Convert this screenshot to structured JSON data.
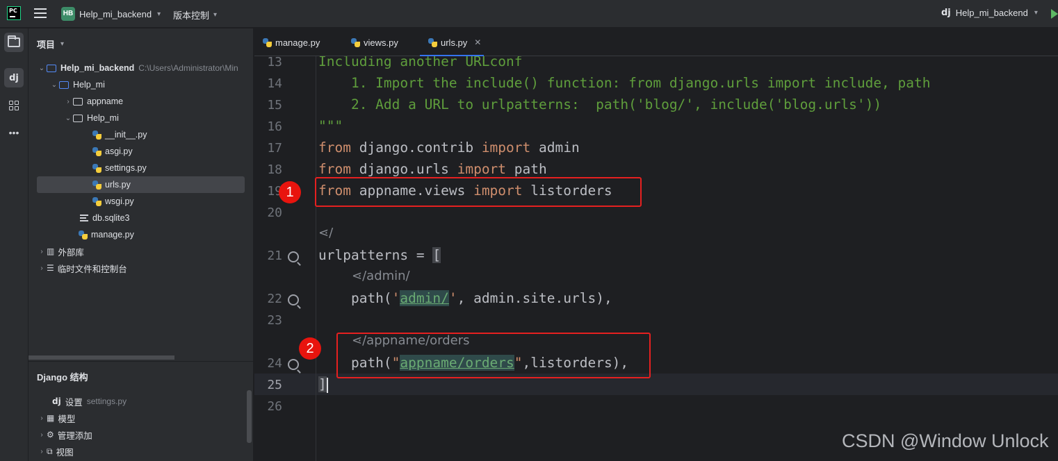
{
  "titlebar": {
    "project_badge": "HB",
    "project_name": "Help_mi_backend",
    "vcs_label": "版本控制",
    "run_config_icon": "dj",
    "run_config_name": "Help_mi_backend"
  },
  "sidebar_strip": {
    "icons": [
      "folder-icon",
      "django-icon",
      "structure-icon",
      "more-icon"
    ]
  },
  "project_panel": {
    "title": "项目",
    "tree": [
      {
        "label": "Help_mi_backend",
        "hint": "C:\\Users\\Administrator\\Min",
        "type": "root-folder",
        "expanded": true
      },
      {
        "label": "Help_mi",
        "type": "folder",
        "expanded": true
      },
      {
        "label": "appname",
        "type": "package",
        "expanded": false
      },
      {
        "label": "Help_mi",
        "type": "package",
        "expanded": true
      },
      {
        "label": "__init__.py",
        "type": "python-file"
      },
      {
        "label": "asgi.py",
        "type": "python-file"
      },
      {
        "label": "settings.py",
        "type": "python-file"
      },
      {
        "label": "urls.py",
        "type": "python-file",
        "selected": true
      },
      {
        "label": "wsgi.py",
        "type": "python-file"
      },
      {
        "label": "db.sqlite3",
        "type": "database-file"
      },
      {
        "label": "manage.py",
        "type": "python-file"
      },
      {
        "label": "外部库",
        "type": "library"
      },
      {
        "label": "临时文件和控制台",
        "type": "scratches"
      }
    ]
  },
  "django_structure": {
    "title": "Django 结构",
    "items": [
      {
        "icon": "dj",
        "label": "设置",
        "hint": "settings.py"
      },
      {
        "icon": "table-icon",
        "label": "模型"
      },
      {
        "icon": "gear-icon",
        "label": "管理添加"
      },
      {
        "icon": "view-icon",
        "label": "视图"
      }
    ]
  },
  "tabs": [
    {
      "label": "manage.py",
      "active": false
    },
    {
      "label": "views.py",
      "active": false
    },
    {
      "label": "urls.py",
      "active": true
    }
  ],
  "editor": {
    "line_numbers": [
      "13",
      "14",
      "15",
      "16",
      "17",
      "18",
      "19",
      "20",
      "21",
      "22",
      "23",
      "24",
      "25",
      "26"
    ],
    "lines": {
      "l13": "Including another URLconf",
      "l14": "    1. Import the include() function: from django.urls import include, path",
      "l15": "    2. Add a URL to urlpatterns:  path('blog/', include('blog.urls'))",
      "l16": "\"\"\"",
      "l17_kw1": "from",
      "l17_mod": " django.contrib ",
      "l17_kw2": "import",
      "l17_name": " admin",
      "l18_kw1": "from",
      "l18_mod": " django.urls ",
      "l18_kw2": "import",
      "l18_name": " path",
      "l19_kw1": "from",
      "l19_mod": " appname.views ",
      "l19_kw2": "import",
      "l19_name": " listorders",
      "hint_root": "/",
      "l21": "urlpatterns = ",
      "l21_bracket": "[",
      "hint_admin": "/admin/",
      "l22_pre": "    path(",
      "l22_q1": "'",
      "l22_str": "admin/",
      "l22_q2": "'",
      "l22_post": ", admin.site.urls),",
      "hint_orders": "/appname/orders",
      "l24_pre": "    path(",
      "l24_q1": "\"",
      "l24_str": "appname/orders",
      "l24_q2": "\"",
      "l24_post": ",listorders),",
      "l25": "]"
    },
    "annotations": [
      "1",
      "2"
    ]
  },
  "watermark": "CSDN @Window Unlock",
  "colors": {
    "keyword": "#cf8e6d",
    "comment": "#5f9e3c",
    "string": "#6aab73",
    "annotation_red": "#e62020",
    "accent_blue": "#3574f0"
  }
}
